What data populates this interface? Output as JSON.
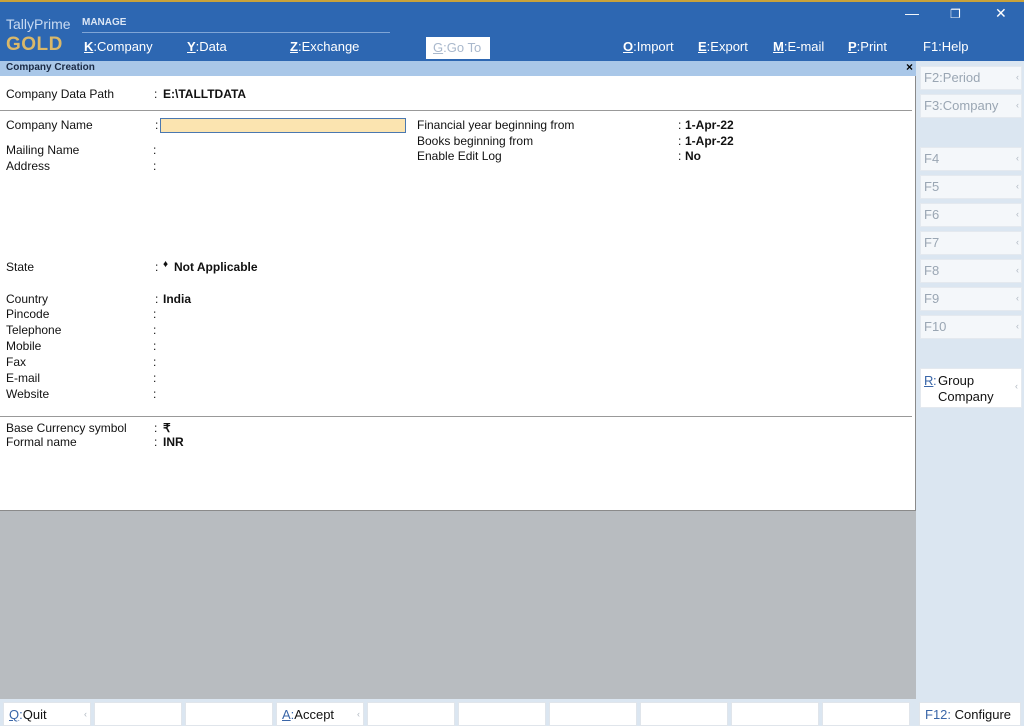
{
  "header": {
    "brand_line1": "TallyPrime",
    "brand_line2": "GOLD",
    "section": "MANAGE",
    "menus": [
      {
        "key": "K",
        "label": "Company"
      },
      {
        "key": "Y",
        "label": "Data"
      },
      {
        "key": "Z",
        "label": "Exchange"
      },
      {
        "key": "G",
        "label": "Go To"
      },
      {
        "key": "O",
        "label": "Import"
      },
      {
        "key": "E",
        "label": "Export"
      },
      {
        "key": "M",
        "label": "E-mail"
      },
      {
        "key": "P",
        "label": "Print"
      },
      {
        "key": "F1",
        "label": "Help"
      }
    ],
    "window_controls": {
      "minimize": "—",
      "restore": "❐",
      "close": "✕"
    }
  },
  "panel": {
    "title": "Company  Creation",
    "close": "×",
    "data_path_label": "Company Data Path",
    "data_path_value": "E:\\TALLTDATA",
    "fields_left": [
      {
        "label": "Company Name",
        "value": ""
      },
      {
        "label": "Mailing Name",
        "value": ""
      },
      {
        "label": "Address",
        "value": ""
      },
      {
        "label": "State",
        "value": "Not Applicable",
        "marker": "♦"
      },
      {
        "label": "Country",
        "value": "India"
      },
      {
        "label": "Pincode",
        "value": ""
      },
      {
        "label": "Telephone",
        "value": ""
      },
      {
        "label": "Mobile",
        "value": ""
      },
      {
        "label": "Fax",
        "value": ""
      },
      {
        "label": "E-mail",
        "value": ""
      },
      {
        "label": "Website",
        "value": ""
      }
    ],
    "fields_right": [
      {
        "label": "Financial year beginning from",
        "value": "1-Apr-22"
      },
      {
        "label": "Books beginning from",
        "value": "1-Apr-22"
      },
      {
        "label": "Enable Edit Log",
        "value": "No"
      }
    ],
    "currency": [
      {
        "label": "Base Currency symbol",
        "value": "₹"
      },
      {
        "label": "Formal name",
        "value": "INR"
      }
    ]
  },
  "sidebar": {
    "keys": [
      {
        "key": "F2",
        "label": "Period"
      },
      {
        "key": "F3",
        "label": "Company"
      },
      {
        "key": "F4",
        "label": ""
      },
      {
        "key": "F5",
        "label": ""
      },
      {
        "key": "F6",
        "label": ""
      },
      {
        "key": "F7",
        "label": ""
      },
      {
        "key": "F8",
        "label": ""
      },
      {
        "key": "F9",
        "label": ""
      },
      {
        "key": "F10",
        "label": ""
      }
    ],
    "group_key": "R",
    "group_label1": "Group",
    "group_label2": "Company",
    "configure_key": "F12",
    "configure_label": "Configure"
  },
  "bottom": {
    "quit_key": "Q",
    "quit_label": "Quit",
    "accept_key": "A",
    "accept_label": "Accept"
  },
  "colors": {
    "header_bg": "#2d67b2",
    "panel_title_bg": "#a9c7e8",
    "input_bg": "#fbe4b0",
    "sidebar_bg": "#dbe6f1",
    "gold": "#d9b86a"
  }
}
